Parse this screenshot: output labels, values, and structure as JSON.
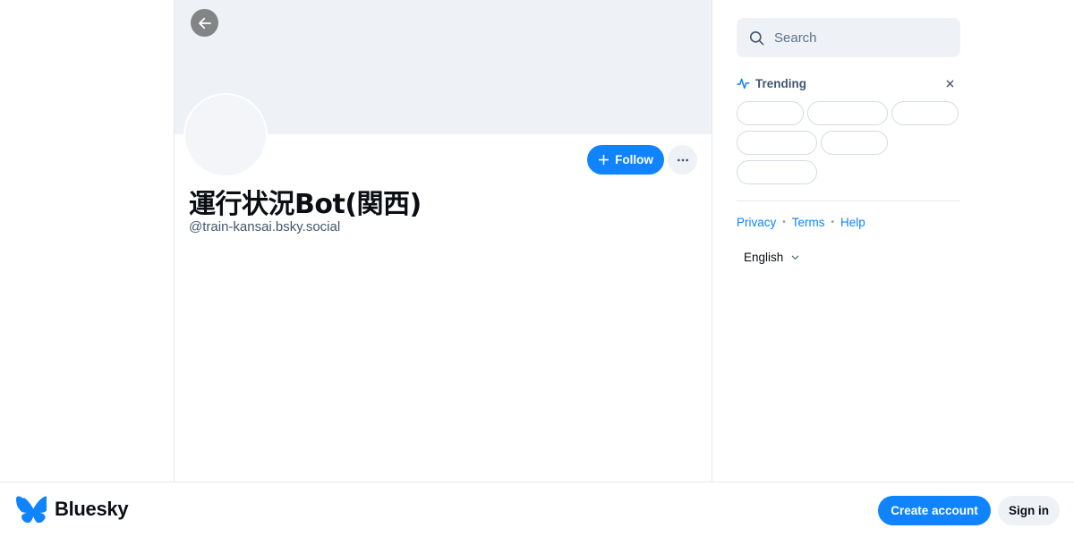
{
  "profile": {
    "display_name": "運行状況Bot(関西)",
    "handle": "@train-kansai.bsky.social",
    "follow_label": "Follow",
    "back_icon": "arrow-left-icon",
    "more_icon": "ellipsis-icon"
  },
  "sidebar": {
    "search_placeholder": "Search",
    "search_icon": "search-icon",
    "trending": {
      "title": "Trending",
      "icon": "trending-icon",
      "close_icon": "close-icon",
      "topics": [
        "",
        "",
        "",
        "",
        "",
        ""
      ]
    },
    "links": [
      "Privacy",
      "Terms",
      "Help"
    ],
    "language": "English"
  },
  "bottom_bar": {
    "logo_text": "Bluesky",
    "create_account_label": "Create account",
    "sign_in_label": "Sign in"
  },
  "colors": {
    "accent": "#1083fe",
    "banner": "#eef1f5",
    "border": "#e4e9ef",
    "muted_text": "#42576c"
  }
}
